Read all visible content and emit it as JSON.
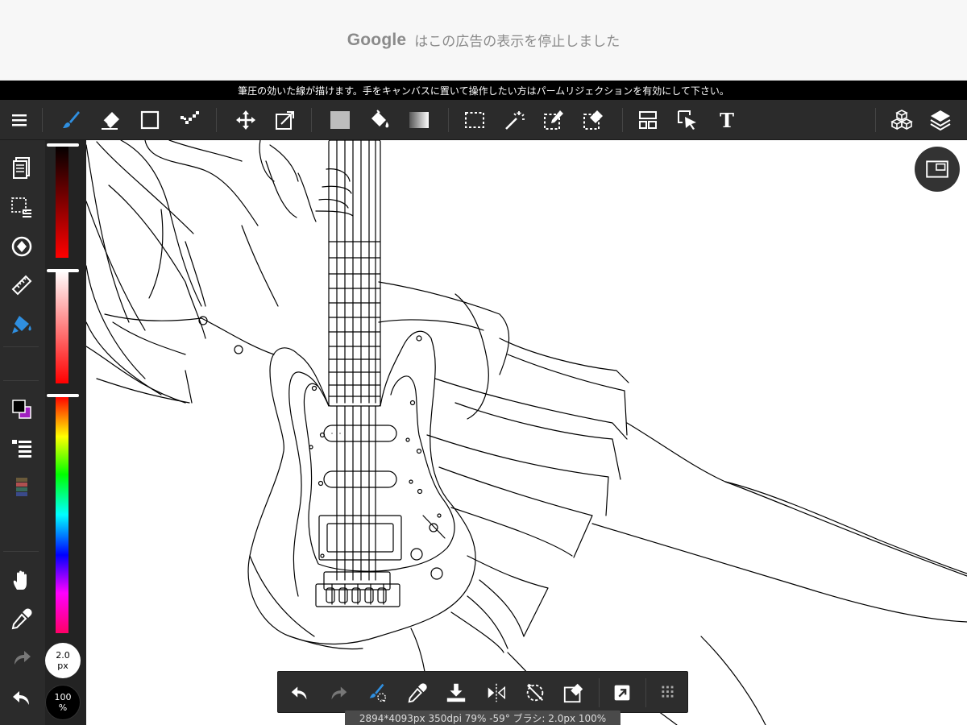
{
  "ad": {
    "brand": "Google",
    "text": "はこの広告の表示を停止しました"
  },
  "hint": {
    "text": "筆圧の効いた線が描けます。手をキャンバスに置いて操作したい方はパームリジェクションを有効にして下さい。"
  },
  "toolbar": {
    "icons": [
      "menu-icon",
      "brush-icon",
      "eraser-icon",
      "rectangle-icon",
      "dot-icon",
      "move-icon",
      "transform-icon",
      "fill-color-icon",
      "bucket-icon",
      "gradient-icon",
      "selection-icon",
      "magic-wand-icon",
      "selection-pen-icon",
      "selection-eraser-icon",
      "layout-icon",
      "select-layer-icon",
      "text-icon",
      "3d-icon",
      "layers-icon"
    ],
    "text_tool_glyph": "T",
    "accent": "#2f8fe0"
  },
  "sidebar": {
    "icons": [
      "pages-icon",
      "selection-list-icon",
      "rotate-icon",
      "ruler-icon",
      "color-fill-icon",
      "color-swatch-icon",
      "layer-list-icon",
      "palette-icon",
      "hand-icon",
      "eyedropper-icon",
      "redo-icon",
      "undo-icon"
    ]
  },
  "colors": {
    "foreground": "#000000",
    "background": "#a020c0",
    "hue_bar": "linear hue spectrum",
    "brightness_top": "#000000",
    "brightness_bottom": "#ff0000"
  },
  "brush_size": {
    "value": "2.0",
    "unit": "px"
  },
  "opacity": {
    "value": "100",
    "unit": "%"
  },
  "quickbar": {
    "icons": [
      "undo-icon",
      "redo-icon",
      "brush-stabilize-icon",
      "eyedropper-icon",
      "save-icon",
      "flip-icon",
      "rotate-reset-icon",
      "clear-icon",
      "share-icon",
      "grid-icon"
    ]
  },
  "status": {
    "text": "2894*4093px 350dpi 79% -59° ブラシ: 2.0px 100%"
  }
}
